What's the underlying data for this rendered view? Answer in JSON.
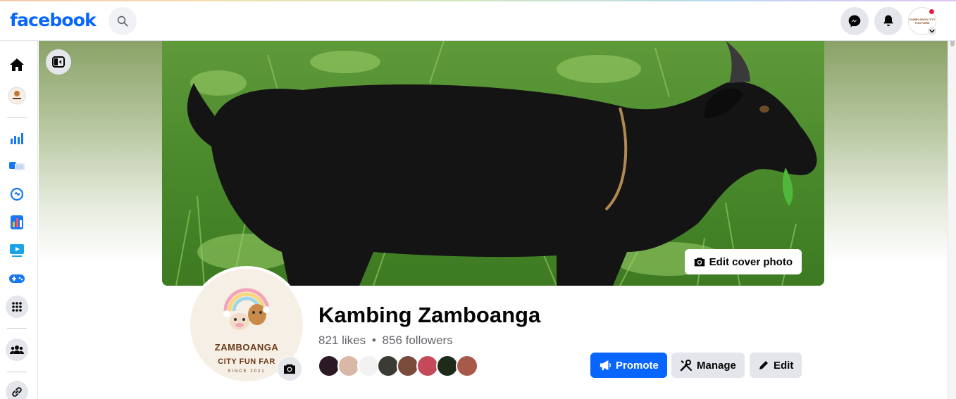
{
  "header": {
    "logo": "facebook",
    "icons": [
      "search-icon",
      "messenger-icon",
      "bell-icon",
      "profile-avatar"
    ],
    "profile_mini_text": "ZAMBOANGA CITY FUN FARM"
  },
  "sidebar": {
    "items": [
      "home-icon",
      "page-avatar",
      "insights-icon",
      "ads-icon",
      "meta-business-icon",
      "dashboard-icon",
      "watch-icon",
      "gaming-icon",
      "apps-grid-icon",
      "groups-icon",
      "link-icon"
    ]
  },
  "cover": {
    "edit_label": "Edit cover photo"
  },
  "profile": {
    "brand_line1": "ZAMBOANGA",
    "brand_line2": "CITY FUN FAR",
    "brand_line3": "SINCE 2021",
    "name": "Kambing Zamboanga",
    "likes": "821 likes",
    "separator": "•",
    "followers": "856 followers"
  },
  "friend_avatars": [
    "#2b1a24",
    "#d9b8a8",
    "#f2f2f2",
    "#3c3a35",
    "#7a4a3a",
    "#c44a5a",
    "#1e2a1a",
    "#a85a4a"
  ],
  "actions": {
    "promote": "Promote",
    "manage": "Manage",
    "edit": "Edit"
  },
  "colors": {
    "brand_blue": "#0866ff",
    "button_grey": "#e4e6eb",
    "text_secondary": "#65676b"
  }
}
